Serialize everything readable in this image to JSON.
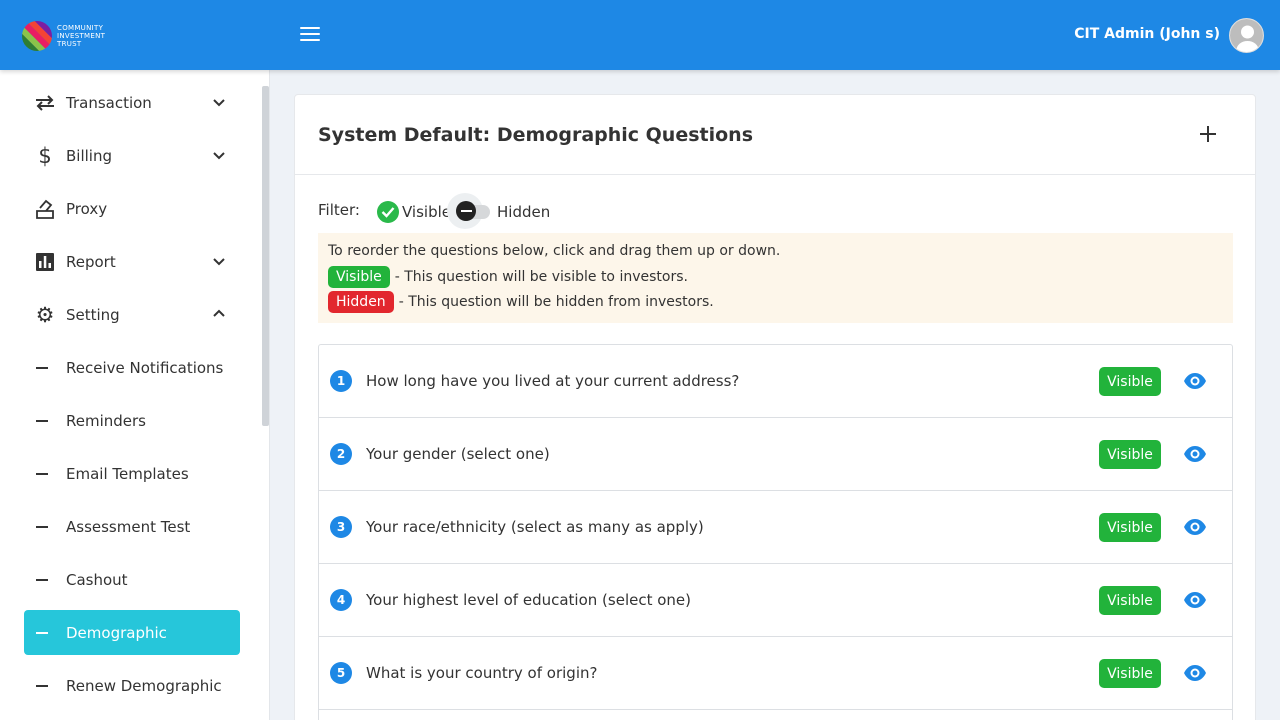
{
  "header": {
    "logo_lines": [
      "COMMUNITY",
      "INVESTMENT",
      "TRUST"
    ],
    "user_name": "CIT Admin (John s)",
    "menu_icon": "hamburger-menu-icon",
    "avatar_icon": "user-avatar-icon",
    "brand_color": "#1e88e5"
  },
  "sidebar": {
    "items": [
      {
        "label": "Transaction",
        "icon": "transfer-arrows-icon",
        "expand": "chevron-down-icon"
      },
      {
        "label": "Billing",
        "icon": "dollar-icon",
        "expand": "chevron-down-icon"
      },
      {
        "label": "Proxy",
        "icon": "ballot-box-icon"
      },
      {
        "label": "Report",
        "icon": "bar-chart-icon",
        "expand": "chevron-down-icon"
      },
      {
        "label": "Setting",
        "icon": "gear-icon",
        "expand": "chevron-up-icon"
      }
    ],
    "sub_items": [
      {
        "label": "Receive Notifications"
      },
      {
        "label": "Reminders"
      },
      {
        "label": "Email Templates"
      },
      {
        "label": "Assessment Test"
      },
      {
        "label": "Cashout"
      },
      {
        "label": "Demographic",
        "active": true
      },
      {
        "label": "Renew Demographic"
      }
    ],
    "active_color": "#26c6da"
  },
  "main": {
    "title": "System Default: Demographic Questions",
    "add_icon": "plus-icon",
    "filter": {
      "label": "Filter:",
      "visible_label": "Visible",
      "hidden_label": "Hidden",
      "visible_checked": true,
      "hidden_toggle_on": false
    },
    "info": {
      "line1": "To reorder the questions below, click and drag them up or down.",
      "visible_badge": "Visible",
      "visible_text": "- This question will be visible to investors.",
      "hidden_badge": "Hidden",
      "hidden_text": "- This question will be hidden from investors."
    },
    "questions": [
      {
        "num": "1",
        "text": "How long have you lived at your current address?",
        "status": "Visible"
      },
      {
        "num": "2",
        "text": "Your gender (select one)",
        "status": "Visible"
      },
      {
        "num": "3",
        "text": "Your race/ethnicity (select as many as apply)",
        "status": "Visible"
      },
      {
        "num": "4",
        "text": "Your highest level of education (select one)",
        "status": "Visible"
      },
      {
        "num": "5",
        "text": "What is your country of origin?",
        "status": "Visible"
      }
    ],
    "status_colors": {
      "visible": "#22b33b",
      "hidden": "#e2272e"
    }
  }
}
